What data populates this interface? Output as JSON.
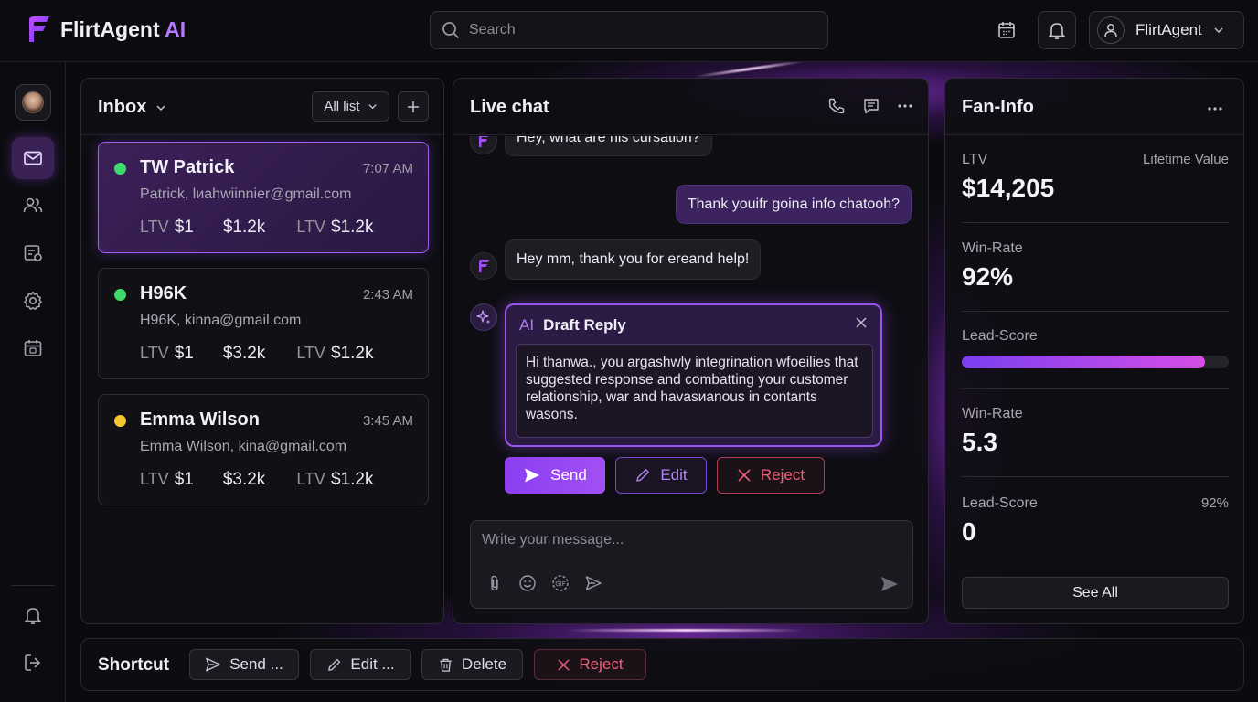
{
  "brand": {
    "name": "FlirtAgent",
    "suffix": "AI"
  },
  "search": {
    "placeholder": "Search"
  },
  "profile": {
    "name": "FlirtAgent"
  },
  "inbox": {
    "title": "Inbox",
    "filter_label": "All list",
    "conversations": [
      {
        "name": "TW Patrick",
        "time": "7:07 AM",
        "email": "Patrick, lиahwiinnier@gmail.com",
        "status_color": "#3ddc6a",
        "ltv1_label": "LTV",
        "ltv1": "$1",
        "mid": "$1.2k",
        "ltv2_label": "LTV",
        "ltv2": "$1.2k"
      },
      {
        "name": "H96K",
        "time": "2:43 AM",
        "email": "H96K, kinna@gmail.com",
        "status_color": "#3ddc6a",
        "ltv1_label": "LTV",
        "ltv1": "$1",
        "mid": "$3.2k",
        "ltv2_label": "LTV",
        "ltv2": "$1.2k"
      },
      {
        "name": "Emma Wilson",
        "time": "3:45 AM",
        "email": "Emma Wilson, kina@gmail.com",
        "status_color": "#f5c531",
        "ltv1_label": "LTV",
        "ltv1": "$1",
        "mid": "$3.2k",
        "ltv2_label": "LTV",
        "ltv2": "$1.2k"
      }
    ]
  },
  "chat": {
    "title": "Live chat",
    "messages": [
      {
        "from": "agent",
        "text": "Hey, what are his cursation?"
      },
      {
        "from": "user",
        "text": "Thank youifr goina info chatooh?"
      },
      {
        "from": "agent",
        "text": "Hey mm, thank you for ereand help!"
      }
    ],
    "draft": {
      "ai_label": "AI",
      "title": "Draft Reply",
      "body": "Hi thanwa., you argashwly integrination wfoeilies that suggested response and combatting your customer relationship, war and havasиanous in contants wasons."
    },
    "actions": {
      "send": "Send",
      "edit": "Edit",
      "reject": "Reject"
    },
    "composer_placeholder": "Write your message..."
  },
  "fan_info": {
    "title": "Fan-Info",
    "ltv_label": "LTV",
    "ltv_caption": "Lifetime Value",
    "ltv_value": "$14,205",
    "win_rate_label": "Win-Rate",
    "win_rate_value": "92%",
    "lead_score_label": "Lead-Score",
    "lead_score_progress": 0.91,
    "win_rate2_label": "Win-Rate",
    "win_rate2_value": "5.3",
    "lead_score2_label": "Lead-Score",
    "lead_score2_percent": "92%",
    "lead_score2_value": "0",
    "see_all": "See All"
  },
  "shortcut": {
    "title": "Shortcut",
    "send": "Send ...",
    "edit": "Edit ...",
    "delete": "Delete",
    "reject": "Reject"
  },
  "colors": {
    "accent": "#9a55ec",
    "danger": "#ef5d7a",
    "online": "#3ddc6a",
    "away": "#f5c531"
  }
}
